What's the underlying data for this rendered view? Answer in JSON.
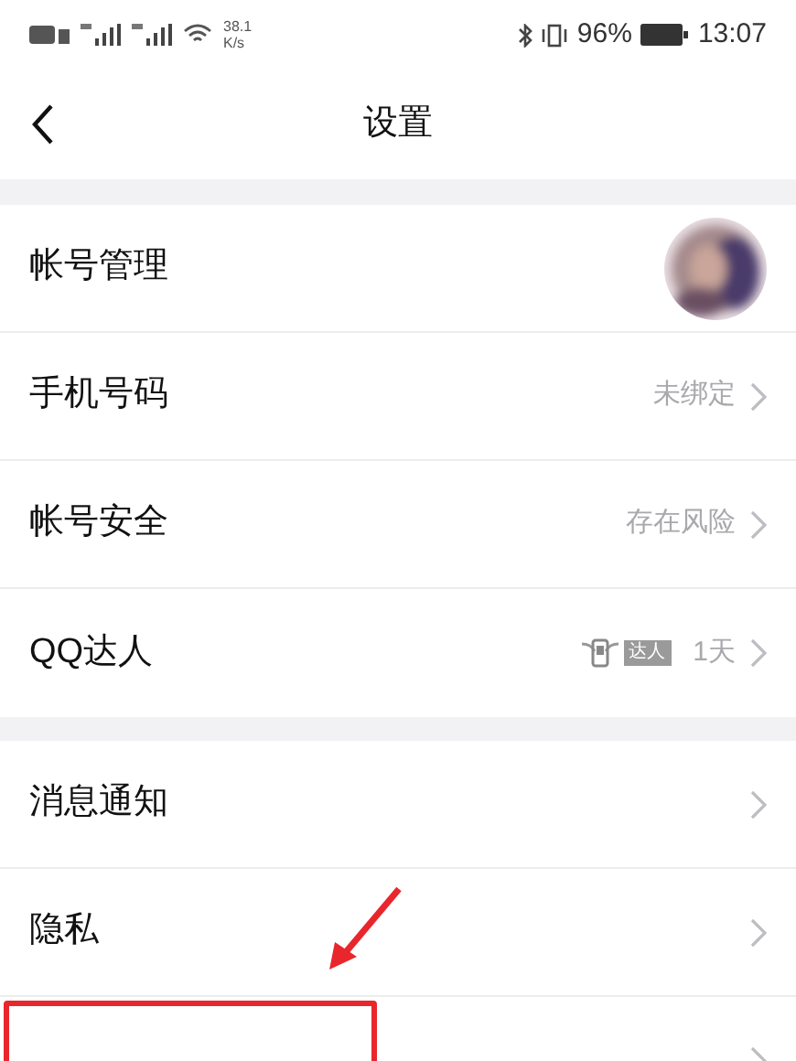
{
  "status_bar": {
    "speed": "38.1",
    "speed_unit": "K/s",
    "battery": "96%",
    "time": "13:07"
  },
  "header": {
    "title": "设置"
  },
  "groups": [
    {
      "rows": [
        {
          "kind": "avatar",
          "label": "帐号管理",
          "highlighted": false
        },
        {
          "kind": "value",
          "label": "手机号码",
          "value": "未绑定",
          "highlighted": false
        },
        {
          "kind": "value",
          "label": "帐号安全",
          "value": "存在风险",
          "highlighted": false
        },
        {
          "kind": "badge",
          "label": "QQ达人",
          "badge": "达人",
          "value": "1天",
          "highlighted": false
        }
      ]
    },
    {
      "rows": [
        {
          "kind": "plain",
          "label": "消息通知",
          "highlighted": false
        },
        {
          "kind": "plain",
          "label": "隐私",
          "highlighted": false
        },
        {
          "kind": "plain",
          "highlighted": true
        }
      ]
    }
  ]
}
